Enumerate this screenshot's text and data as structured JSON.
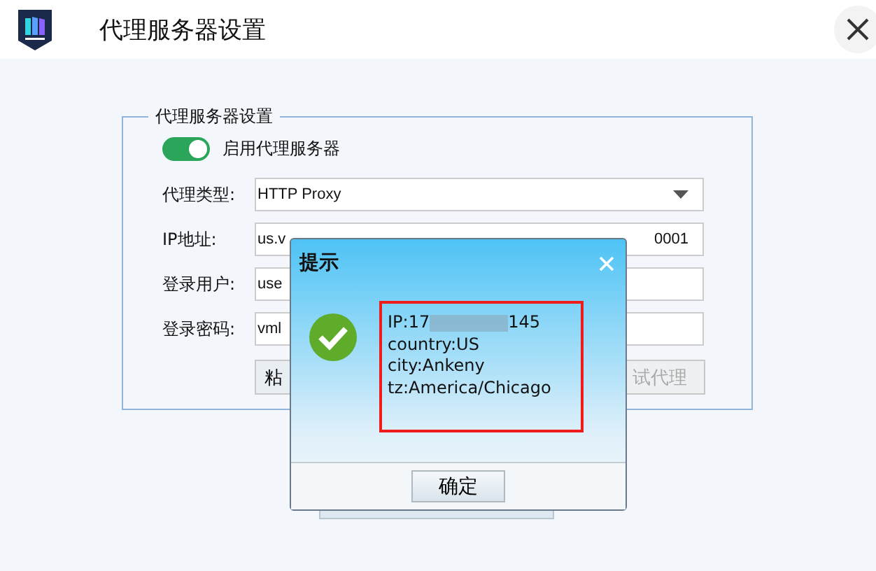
{
  "window": {
    "title": "代理服务器设置"
  },
  "group": {
    "title": "代理服务器设置",
    "toggle": {
      "label": "启用代理服务器",
      "on": true
    },
    "rows": [
      {
        "kind": "select",
        "label": "代理类型:",
        "value_start": "HTTP Proxy"
      },
      {
        "kind": "input",
        "label": "IP地址:",
        "value_start": "us.v",
        "value_end": "0001"
      },
      {
        "kind": "input",
        "label": "登录用户:",
        "value_start": "use"
      },
      {
        "kind": "input",
        "label": "登录密码:",
        "value_start": "vml"
      }
    ],
    "buttons": [
      {
        "label": "粘",
        "disabled": false
      },
      {
        "label": "试代理",
        "disabled": true
      }
    ]
  },
  "dialog": {
    "title": "提示",
    "ip_start": "IP:17",
    "ip_end": "145",
    "lines": [
      "country:US",
      "city:Ankeny",
      "tz:America/Chicago"
    ],
    "ok": "确定"
  }
}
